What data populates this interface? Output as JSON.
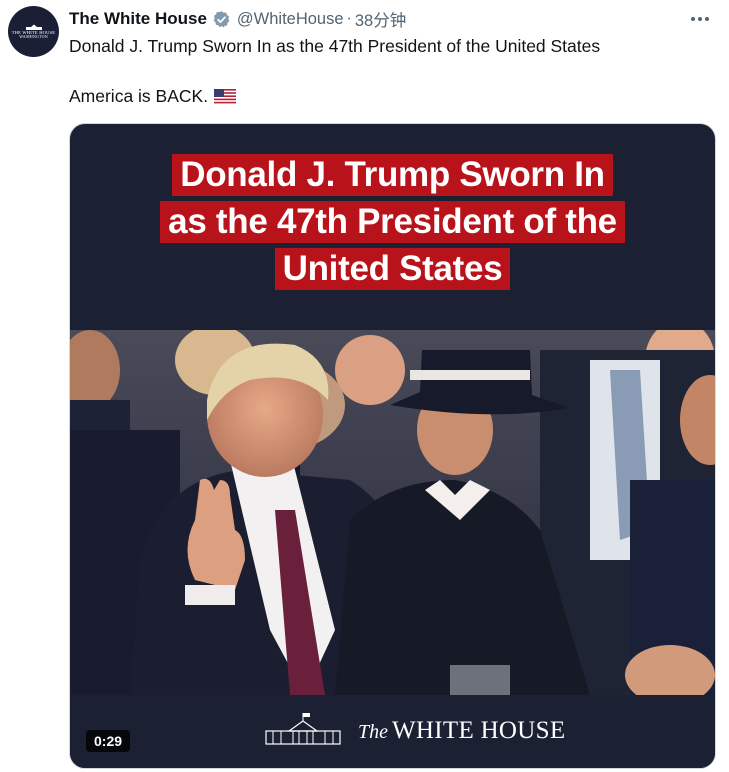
{
  "author": {
    "display_name": "The White House",
    "handle": "@WhiteHouse",
    "separator": "·",
    "time": "38分钟",
    "avatar_text_top": "THE WHITE HOUSE",
    "avatar_text_bottom": "WASHINGTON"
  },
  "tweet": {
    "text_line1": "Donald J. Trump Sworn In as the 47th President of the United States",
    "text_line2": "America is BACK.",
    "emoji": "us-flag"
  },
  "media": {
    "title_lines": [
      "Donald J. Trump Sworn In",
      "as the 47th President of the",
      "United States"
    ],
    "logo_the": "The",
    "logo_white_house": "WHITE HOUSE",
    "duration": "0:29"
  },
  "icons": {
    "verified": "verified-badge-icon",
    "more": "more-horizontal-icon"
  },
  "colors": {
    "banner_red": "#b8121b",
    "video_background": "#1b2033",
    "secondary_text": "#536471",
    "verified_badge": "#829aab"
  }
}
